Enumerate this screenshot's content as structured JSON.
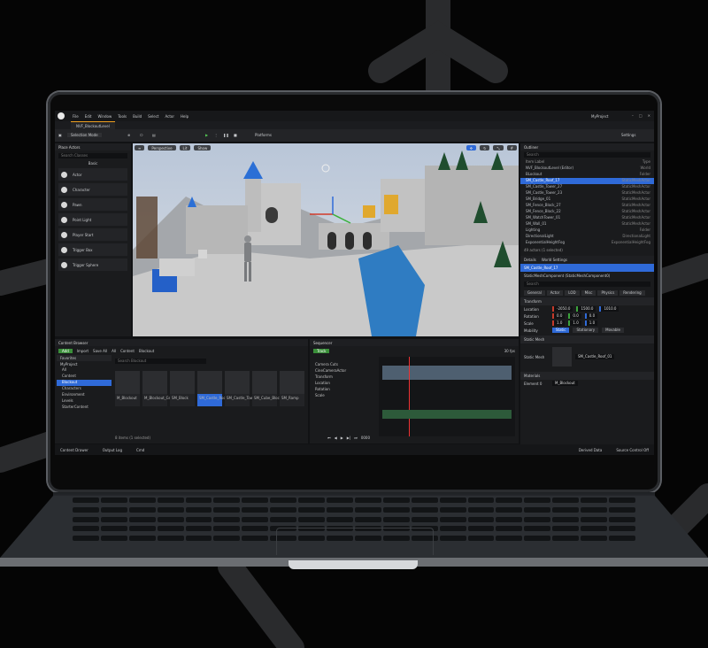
{
  "menubar": {
    "items": [
      "File",
      "Edit",
      "Window",
      "Tools",
      "Build",
      "Select",
      "Actor",
      "Help"
    ],
    "project": "MyProject"
  },
  "tab": {
    "label": "NVF_BlockoutLevel"
  },
  "toolbar": {
    "mode": "Selection Mode",
    "platforms": "Platforms",
    "settings": "Settings"
  },
  "place_actors": {
    "title": "Place Actors",
    "search_placeholder": "Search Classes",
    "section": "Basic",
    "items": [
      {
        "label": "Actor",
        "icon": "actor-icon"
      },
      {
        "label": "Character",
        "icon": "character-icon"
      },
      {
        "label": "Pawn",
        "icon": "pawn-icon"
      },
      {
        "label": "Point Light",
        "icon": "light-icon"
      },
      {
        "label": "Player Start",
        "icon": "player-start-icon"
      },
      {
        "label": "Trigger Box",
        "icon": "trigger-box-icon"
      },
      {
        "label": "Trigger Sphere",
        "icon": "trigger-sphere-icon"
      }
    ]
  },
  "viewport": {
    "perspective": "Perspective",
    "lit": "Lit",
    "show": "Show"
  },
  "outliner": {
    "title": "Outliner",
    "search_placeholder": "Search",
    "col_label": "Item Label",
    "col_type": "Type",
    "rows": [
      {
        "label": "NVF_BlockoutLevel (Editor)",
        "type": "World",
        "sel": false
      },
      {
        "label": "BLockout",
        "type": "Folder",
        "sel": false
      },
      {
        "label": "SM_Castle_Roof_17",
        "type": "StaticMeshActor",
        "sel": true
      },
      {
        "label": "SM_Castle_Tower_27",
        "type": "StaticMeshActor",
        "sel": false
      },
      {
        "label": "SM_Castle_Tower_23",
        "type": "StaticMeshActor",
        "sel": false
      },
      {
        "label": "SM_Bridge_01",
        "type": "StaticMeshActor",
        "sel": false
      },
      {
        "label": "SM_Fence_Block_27",
        "type": "StaticMeshActor",
        "sel": false
      },
      {
        "label": "SM_Fence_Block_22",
        "type": "StaticMeshActor",
        "sel": false
      },
      {
        "label": "SM_WatchTower_01",
        "type": "StaticMeshActor",
        "sel": false
      },
      {
        "label": "SM_Wall_01",
        "type": "StaticMeshActor",
        "sel": false
      },
      {
        "label": "Lighting",
        "type": "Folder",
        "sel": false
      },
      {
        "label": "DirectionalLight",
        "type": "DirectionalLight",
        "sel": false
      },
      {
        "label": "ExponentialHeightFog",
        "type": "ExponentialHeightFog",
        "sel": false
      }
    ],
    "count": "49 actors (1 selected)"
  },
  "details": {
    "tab_details": "Details",
    "tab_world": "World Settings",
    "actor": "SM_Castle_Roof_17",
    "component": "StaticMeshComponent (StaticMeshComponent0)",
    "search_placeholder": "Search",
    "categories": [
      "General",
      "Actor",
      "LOD",
      "Misc",
      "Physics",
      "Rendering"
    ],
    "transform": "Transform",
    "location_label": "Location",
    "rotation_label": "Rotation",
    "scale_label": "Scale",
    "location": [
      "-2050.0",
      "1500.0",
      "1010.0"
    ],
    "rotation": [
      "0.0",
      "0.0",
      "0.0"
    ],
    "scale": [
      "1.0",
      "1.0",
      "1.0"
    ],
    "mobility_label": "Mobility",
    "mobility": [
      "Static",
      "Stationary",
      "Movable"
    ],
    "static_mesh_section": "Static Mesh",
    "static_mesh_label": "Static Mesh",
    "static_mesh": "SM_Castle_Roof_01",
    "materials_section": "Materials",
    "element0_label": "Element 0",
    "material": "M_Blockout"
  },
  "content_browser": {
    "title": "Content Browser",
    "add": "Add",
    "import": "Import",
    "save_all": "Save All",
    "path": [
      "All",
      "Content",
      "Blockout"
    ],
    "search_placeholder": "Search Blockout",
    "favorites": "Favorites",
    "project": "MyProject",
    "tree": [
      {
        "label": "All",
        "sel": false
      },
      {
        "label": "Content",
        "sel": false
      },
      {
        "label": "Blockout",
        "sel": true
      },
      {
        "label": "Characters",
        "sel": false
      },
      {
        "label": "Environment",
        "sel": false
      },
      {
        "label": "Levels",
        "sel": false
      },
      {
        "label": "StarterContent",
        "sel": false
      }
    ],
    "assets": [
      {
        "label": "M_Blockout",
        "sel": false
      },
      {
        "label": "M_Blockout_Grid",
        "sel": false
      },
      {
        "label": "SM_Block",
        "sel": false
      },
      {
        "label": "SM_Castle_Roof_01",
        "sel": true
      },
      {
        "label": "SM_Castle_Tower_01",
        "sel": false
      },
      {
        "label": "SM_Cube_Block_01",
        "sel": false
      },
      {
        "label": "SM_Ramp",
        "sel": false
      }
    ],
    "count": "8 items (1 selected)"
  },
  "sequencer": {
    "title": "Sequencer",
    "track": "Track",
    "fps": "30 fps",
    "tracks": [
      "Camera Cuts",
      "CineCameraActor",
      "Transform",
      "Location",
      "Rotation",
      "Scale"
    ],
    "frame": "0000"
  },
  "status": {
    "content_drawer": "Content Drawer",
    "output_log": "Output Log",
    "cmd": "Cmd",
    "derived_data": "Derived Data",
    "source_control": "Source Control Off"
  },
  "colors": {
    "accent": "#2f6ad8",
    "play": "#53c653",
    "tab": "#f0a020"
  }
}
